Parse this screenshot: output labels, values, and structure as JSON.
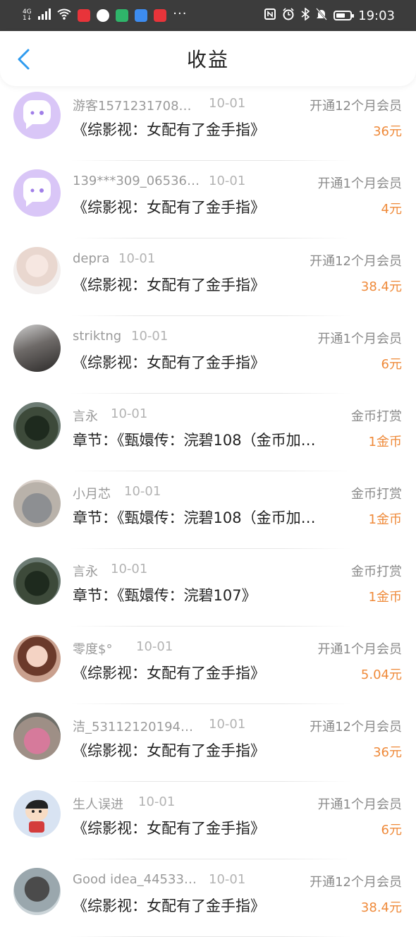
{
  "status_bar": {
    "network": "4G",
    "network_sub": "1↓",
    "time": "19:03",
    "more": "···",
    "icons": [
      "signal-icon",
      "wifi-icon",
      "app-red-icon",
      "app-ball-icon",
      "app-home-icon",
      "app-cloud-icon",
      "app-book-icon",
      "nfc-icon",
      "alarm-icon",
      "bluetooth-icon",
      "mute-icon",
      "battery-icon"
    ],
    "app_colors": [
      "#e8343a",
      "#ffffff",
      "#2fb56a",
      "#3d8cf0",
      "#e8343a"
    ]
  },
  "header": {
    "title": "收益",
    "back_icon": "chevron-left-icon",
    "accent": "#2f9bef"
  },
  "colors": {
    "amount": "#ef8a3a",
    "username": "#9a9a9a",
    "date": "#b3b3b3"
  },
  "records": [
    {
      "user": "游客1571231708…",
      "date": "10-01",
      "type": "开通12个月会员",
      "book": "《综影视：女配有了金手指》",
      "amount": "36元",
      "avatar": "chat-bubble-avatar"
    },
    {
      "user": "139***309_06536…",
      "date": "10-01",
      "type": "开通1个月会员",
      "book": "《综影视：女配有了金手指》",
      "amount": "4元",
      "avatar": "chat-bubble-avatar"
    },
    {
      "user": "depra",
      "date": "10-01",
      "type": "开通12个月会员",
      "book": "《综影视：女配有了金手指》",
      "amount": "38.4元",
      "avatar": "girl-avatar"
    },
    {
      "user": "striktng",
      "date": "10-01",
      "type": "开通1个月会员",
      "book": "《综影视：女配有了金手指》",
      "amount": "6元",
      "avatar": "girl-avatar"
    },
    {
      "user": "言永",
      "date": "10-01",
      "type": "金币打赏",
      "book": "章节：《甄嬛传：浣碧108（金币加…",
      "amount": "1金币",
      "avatar": "cat-avatar"
    },
    {
      "user": "小月芯",
      "date": "10-01",
      "type": "金币打赏",
      "book": "章节：《甄嬛传：浣碧108（金币加…",
      "amount": "1金币",
      "avatar": "plush-avatar"
    },
    {
      "user": "言永",
      "date": "10-01",
      "type": "金币打赏",
      "book": "章节：《甄嬛传：浣碧107》",
      "amount": "1金币",
      "avatar": "cat-avatar"
    },
    {
      "user": "零度$°",
      "date": "10-01",
      "type": "开通1个月会员",
      "book": "《综影视：女配有了金手指》",
      "amount": "5.04元",
      "avatar": "girl-avatar"
    },
    {
      "user": "洁_53112120194…",
      "date": "10-01",
      "type": "开通12个月会员",
      "book": "《综影视：女配有了金手指》",
      "amount": "36元",
      "avatar": "child-avatar"
    },
    {
      "user": "生人误进",
      "date": "10-01",
      "type": "开通1个月会员",
      "book": "《综影视：女配有了金手指》",
      "amount": "6元",
      "avatar": "cartoon-avatar"
    },
    {
      "user": "Good idea_44533…",
      "date": "10-01",
      "type": "开通12个月会员",
      "book": "《综影视：女配有了金手指》",
      "amount": "38.4元",
      "avatar": "man-avatar"
    }
  ]
}
